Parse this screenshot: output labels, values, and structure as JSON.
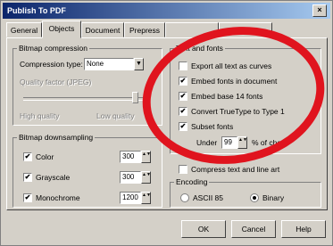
{
  "window": {
    "title": "Publish To PDF",
    "close_glyph": "×"
  },
  "tabs": [
    {
      "label": "General"
    },
    {
      "label": "Objects"
    },
    {
      "label": "Document"
    },
    {
      "label": "Prepress"
    },
    {
      "label": ""
    },
    {
      "label": ""
    }
  ],
  "bitmap_compression": {
    "legend": "Bitmap compression",
    "type_label": "Compression type:",
    "type_value": "None",
    "quality_label": "Quality factor (JPEG)",
    "high_quality": "High quality",
    "low_quality": "Low quality"
  },
  "bitmap_downsampling": {
    "legend": "Bitmap downsampling",
    "rows": [
      {
        "label": "Color",
        "checked": true,
        "value": "300"
      },
      {
        "label": "Grayscale",
        "checked": true,
        "value": "300"
      },
      {
        "label": "Monochrome",
        "checked": true,
        "value": "1200"
      }
    ]
  },
  "text_fonts": {
    "legend": "Text and fonts",
    "options": [
      {
        "label": "Export all text as curves",
        "checked": false
      },
      {
        "label": "Embed fonts in document",
        "checked": true
      },
      {
        "label": "Embed base 14 fonts",
        "checked": true
      },
      {
        "label": "Convert TrueType to Type 1",
        "checked": true
      },
      {
        "label": "Subset fonts",
        "checked": true
      }
    ],
    "under_label": "Under",
    "under_value": "99",
    "of_chars_label": "% of chars"
  },
  "extra_option": {
    "label": "Compress text and line art",
    "checked": false
  },
  "encoding": {
    "legend": "Encoding",
    "options": [
      {
        "label": "ASCII 85",
        "selected": false
      },
      {
        "label": "Binary",
        "selected": true
      }
    ]
  },
  "buttons": {
    "ok": "OK",
    "cancel": "Cancel",
    "help": "Help"
  },
  "check_glyph": "✔",
  "spin_glyph": "▲▼",
  "colors": {
    "titlebar_start": "#0a246a",
    "titlebar_end": "#a6caf0",
    "highlight_circle": "#e0141e",
    "dialog_face": "#d4d0c8"
  }
}
